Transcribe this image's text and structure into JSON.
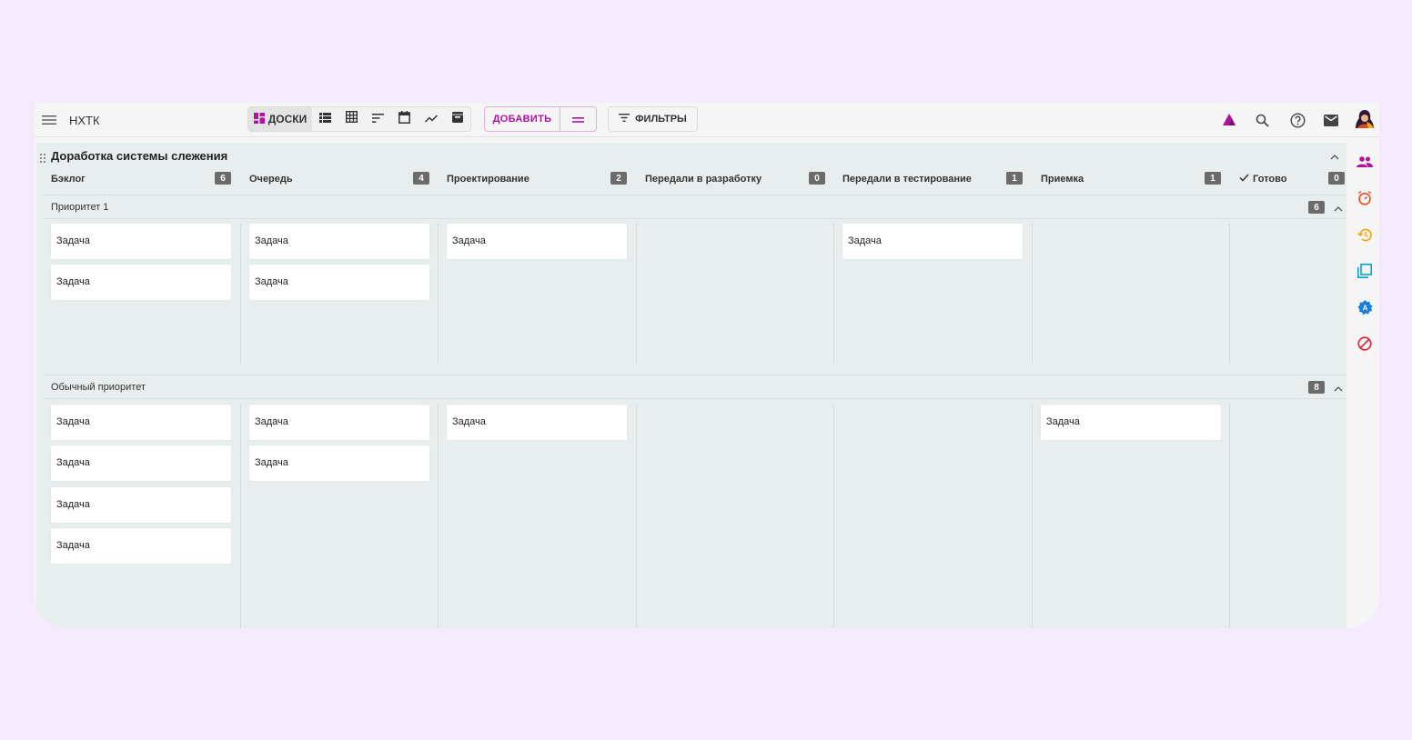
{
  "topbar": {
    "title": "НХТК",
    "views": {
      "boards_label": "ДОСКИ"
    },
    "add_label": "ДОБАВИТЬ",
    "filters_label": "ФИЛЬТРЫ"
  },
  "board": {
    "title": "Доработка системы слежения",
    "columns": [
      {
        "label": "Бэклог",
        "count": "6"
      },
      {
        "label": "Очередь",
        "count": "4"
      },
      {
        "label": "Проектирование",
        "count": "2"
      },
      {
        "label": "Передали в разработку",
        "count": "0"
      },
      {
        "label": "Передали в тестирование",
        "count": "1"
      },
      {
        "label": "Приемка",
        "count": "1"
      },
      {
        "label": "Готово",
        "count": "0"
      }
    ],
    "swimlanes": [
      {
        "label": "Приоритет 1",
        "count": "6",
        "cards": [
          [
            "Задача",
            "Задача"
          ],
          [
            "Задача",
            "Задача"
          ],
          [
            "Задача"
          ],
          [],
          [
            "Задача"
          ],
          [],
          []
        ]
      },
      {
        "label": "Обычный приоритет",
        "count": "8",
        "cards": [
          [
            "Задача",
            "Задача",
            "Задача",
            "Задача"
          ],
          [
            "Задача",
            "Задача"
          ],
          [
            "Задача"
          ],
          [],
          [],
          [
            "Задача"
          ],
          []
        ]
      }
    ]
  },
  "colors": {
    "accent": "#b0129f",
    "background": "#f4eafb",
    "board": "#e8eded",
    "badge": "#6b6b6b"
  },
  "icons": {
    "topbar_right": [
      "brand-logo-icon",
      "search-icon",
      "help-icon",
      "mail-icon",
      "user-avatar"
    ],
    "sidebar": [
      "team-icon",
      "timer-icon",
      "history-icon",
      "copy-icon",
      "verified-badge-icon",
      "block-icon"
    ]
  }
}
